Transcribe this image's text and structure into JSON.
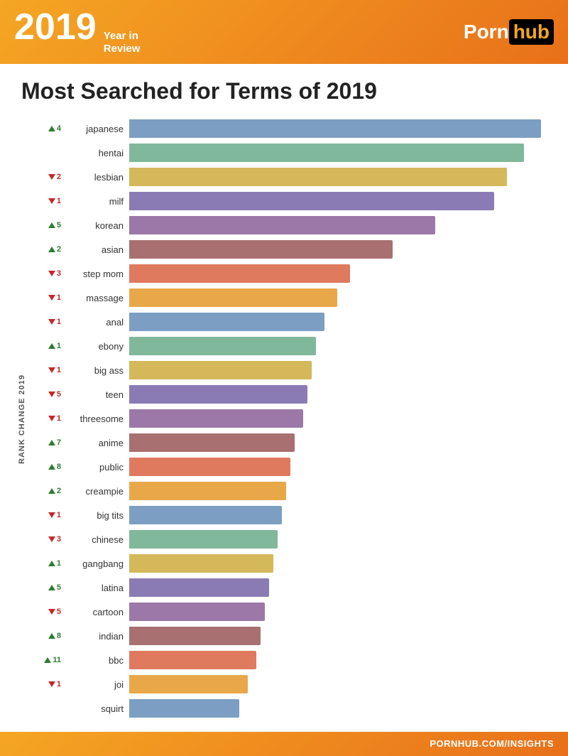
{
  "header": {
    "year": "2019",
    "subtitle_line1": "Year in",
    "subtitle_line2": "Review",
    "logo_part1": "Porn",
    "logo_part2": "hub"
  },
  "main_title": "Most Searched for Terms of 2019",
  "y_axis_label": "RANK CHANGE 2019",
  "footer_text": "PORNHUB.COM/INSIGHTS",
  "bars": [
    {
      "term": "japanese",
      "direction": "up",
      "change": "4",
      "pct": 97,
      "color": "#7B9EC2"
    },
    {
      "term": "hentai",
      "direction": "none",
      "change": "",
      "pct": 93,
      "color": "#7FB89A"
    },
    {
      "term": "lesbian",
      "direction": "down",
      "change": "2",
      "pct": 89,
      "color": "#D4B85A"
    },
    {
      "term": "milf",
      "direction": "down",
      "change": "1",
      "pct": 86,
      "color": "#8B7BB5"
    },
    {
      "term": "korean",
      "direction": "up",
      "change": "5",
      "pct": 72,
      "color": "#9B78A8"
    },
    {
      "term": "asian",
      "direction": "up",
      "change": "2",
      "pct": 62,
      "color": "#A87070"
    },
    {
      "term": "step mom",
      "direction": "down",
      "change": "3",
      "pct": 52,
      "color": "#E07A5F"
    },
    {
      "term": "massage",
      "direction": "down",
      "change": "1",
      "pct": 49,
      "color": "#E8A84A"
    },
    {
      "term": "anal",
      "direction": "down",
      "change": "1",
      "pct": 46,
      "color": "#7B9EC2"
    },
    {
      "term": "ebony",
      "direction": "up",
      "change": "1",
      "pct": 44,
      "color": "#7FB89A"
    },
    {
      "term": "big ass",
      "direction": "down",
      "change": "1",
      "pct": 43,
      "color": "#D4B85A"
    },
    {
      "term": "teen",
      "direction": "down",
      "change": "5",
      "pct": 42,
      "color": "#8B7BB5"
    },
    {
      "term": "threesome",
      "direction": "down",
      "change": "1",
      "pct": 41,
      "color": "#9B78A8"
    },
    {
      "term": "anime",
      "direction": "up",
      "change": "7",
      "pct": 39,
      "color": "#A87070"
    },
    {
      "term": "public",
      "direction": "up",
      "change": "8",
      "pct": 38,
      "color": "#E07A5F"
    },
    {
      "term": "creampie",
      "direction": "up",
      "change": "2",
      "pct": 37,
      "color": "#E8A84A"
    },
    {
      "term": "big tits",
      "direction": "down",
      "change": "1",
      "pct": 36,
      "color": "#7B9EC2"
    },
    {
      "term": "chinese",
      "direction": "down",
      "change": "3",
      "pct": 35,
      "color": "#7FB89A"
    },
    {
      "term": "gangbang",
      "direction": "up",
      "change": "1",
      "pct": 34,
      "color": "#D4B85A"
    },
    {
      "term": "latina",
      "direction": "up",
      "change": "5",
      "pct": 33,
      "color": "#8B7BB5"
    },
    {
      "term": "cartoon",
      "direction": "down",
      "change": "5",
      "pct": 32,
      "color": "#9B78A8"
    },
    {
      "term": "indian",
      "direction": "up",
      "change": "8",
      "pct": 31,
      "color": "#A87070"
    },
    {
      "term": "bbc",
      "direction": "up",
      "change": "11",
      "pct": 30,
      "color": "#E07A5F"
    },
    {
      "term": "joi",
      "direction": "down",
      "change": "1",
      "pct": 28,
      "color": "#E8A84A"
    },
    {
      "term": "squirt",
      "direction": "none",
      "change": "",
      "pct": 26,
      "color": "#7B9EC2"
    }
  ]
}
